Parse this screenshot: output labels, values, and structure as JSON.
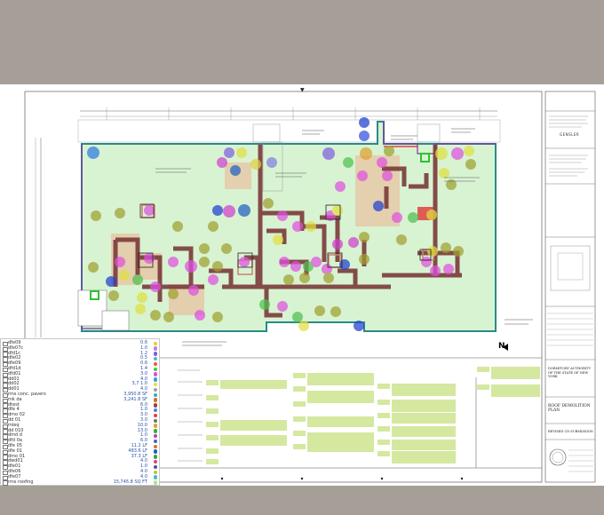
{
  "north_label": "N",
  "nav_marker": "▼",
  "layer_panel": {
    "rows": [
      {
        "name": "dfe09",
        "value": "0.6",
        "color": "#e6d020"
      },
      {
        "name": "dfe07c",
        "value": "1.0",
        "color": "#c080e0"
      },
      {
        "name": "dfd1c",
        "value": "1.2",
        "color": "#8060e0"
      },
      {
        "name": "dfe02",
        "value": "0.5",
        "color": "#50b0e0"
      },
      {
        "name": "dfe09",
        "value": "0.6",
        "color": "#e06030"
      },
      {
        "name": "dfd1d",
        "value": "1.4",
        "color": "#50c050"
      },
      {
        "name": "dfd01",
        "value": "3.0",
        "color": "#e050e0"
      },
      {
        "name": "dd01",
        "value": "4.0",
        "color": "#30a0e0"
      },
      {
        "name": "dd02",
        "value": "3,7 1.0",
        "color": "#e0e040"
      },
      {
        "name": "dd01",
        "value": "4.0",
        "color": "#a0a0a0"
      },
      {
        "name": "rms conc. pavers",
        "value": "3,950.8 SF",
        "color": "#30b0b0"
      },
      {
        "name": "mk da",
        "value": "3,241.8 SF",
        "color": "#d07030"
      },
      {
        "name": "dtest",
        "value": "6.0",
        "color": "#a04040"
      },
      {
        "name": "dfe 4",
        "value": "1.0",
        "color": "#5080e0"
      },
      {
        "name": "dmo 02",
        "value": "3.0",
        "color": "#e04040"
      },
      {
        "name": "dd 01",
        "value": "3.0",
        "color": "#707070"
      },
      {
        "name": "mleq",
        "value": "10.0",
        "color": "#e0a030"
      },
      {
        "name": "dd 010",
        "value": "13.0",
        "color": "#30b030"
      },
      {
        "name": "dmd d",
        "value": "1.0",
        "color": "#b040b0"
      },
      {
        "name": "dfd 0a",
        "value": "6.0",
        "color": "#4060d0"
      },
      {
        "name": "dfe 05",
        "value": "11.2 LF",
        "color": "#e07020"
      },
      {
        "name": "dfe 01",
        "value": "483.6 LF",
        "color": "#2060c0"
      },
      {
        "name": "dmo 01",
        "value": "37.3 LF",
        "color": "#40a040"
      },
      {
        "name": "dwd01",
        "value": "4.0",
        "color": "#e04080"
      },
      {
        "name": "dfe01",
        "value": "1.0",
        "color": "#5050a0"
      },
      {
        "name": "dfe06",
        "value": "4.0",
        "color": "#c0c040"
      },
      {
        "name": "dfe07",
        "value": "4.0",
        "color": "#40c0c0"
      },
      {
        "name": "rms roofing",
        "value": "15,745.8 SQ FT",
        "color": "#b0e0a0"
      }
    ]
  },
  "title_block": {
    "firm_name": "GENSLER",
    "project": "DORMITORY AUTHORITY OF THE STATE OF NEW YORK",
    "drawing_title": "ROOF DEMOLITION PLAN",
    "status": "REVISED CD SUBMISSION"
  },
  "colors": {
    "roof_fill": "#d8f3d2",
    "roof_border": "#2a8a8a",
    "parapet": "#7a3a3a",
    "legend_box": "#d4e8a0",
    "purple_outline": "#7a3aa0",
    "red_outline": "#e02020"
  }
}
